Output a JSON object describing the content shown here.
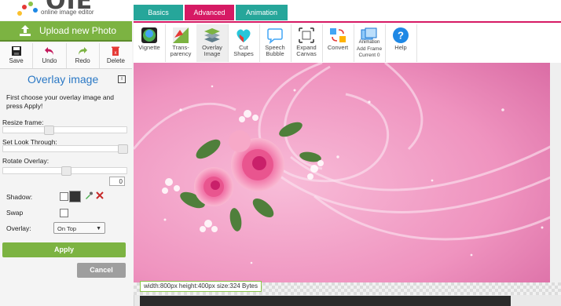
{
  "logo": {
    "text": "OIE",
    "subtitle": "online image editor"
  },
  "upload": {
    "label": "Upload new Photo"
  },
  "edit_buttons": [
    {
      "label": "Save",
      "icon": "floppy-icon"
    },
    {
      "label": "Undo",
      "icon": "undo-icon"
    },
    {
      "label": "Redo",
      "icon": "redo-icon"
    },
    {
      "label": "Delete",
      "icon": "trash-icon"
    }
  ],
  "panel": {
    "title": "Overlay image",
    "help": "i",
    "instructions": "First choose your overlay image and press Apply!",
    "resize_label": "Resize frame:",
    "resize_value": 0.37,
    "look_label": "Set Look Through:",
    "look_value": 1.0,
    "rotate_label": "Rotate Overlay:",
    "rotate_value": 0.5,
    "rotate_input": "0",
    "shadow_label": "Shadow:",
    "swap_label": "Swap",
    "overlay_label": "Overlay:",
    "overlay_selected": "On Top",
    "apply": "Apply",
    "cancel": "Cancel"
  },
  "tabs": [
    {
      "label": "Basics",
      "color": "#26a69a"
    },
    {
      "label": "Advanced",
      "color": "#d61a64"
    },
    {
      "label": "Animation",
      "color": "#26a69a"
    }
  ],
  "tools": [
    {
      "lines": [
        "Vignette"
      ],
      "icon": "vignette-icon"
    },
    {
      "lines": [
        "Trans-",
        "parency"
      ],
      "icon": "transparency-icon"
    },
    {
      "lines": [
        "Overlay",
        "Image"
      ],
      "icon": "overlay-image-icon"
    },
    {
      "lines": [
        "Cut",
        "Shapes"
      ],
      "icon": "heart-icon"
    },
    {
      "lines": [
        "Speech",
        "Bubble"
      ],
      "icon": "speech-bubble-icon"
    },
    {
      "lines": [
        "Expand",
        "Canvas"
      ],
      "icon": "expand-icon"
    },
    {
      "lines": [
        "Convert"
      ],
      "icon": "convert-icon"
    },
    {
      "lines": [
        "Add Frame",
        "Current 0"
      ],
      "icon": "animation-icon",
      "caption": "Animation"
    },
    {
      "lines": [
        "Help"
      ],
      "icon": "help-icon"
    }
  ],
  "status": "width:800px  height:400px  size:324 Bytes",
  "colors": {
    "accent_green": "#7cb342",
    "accent_pink": "#d61a64",
    "title_blue": "#2a78c5"
  }
}
